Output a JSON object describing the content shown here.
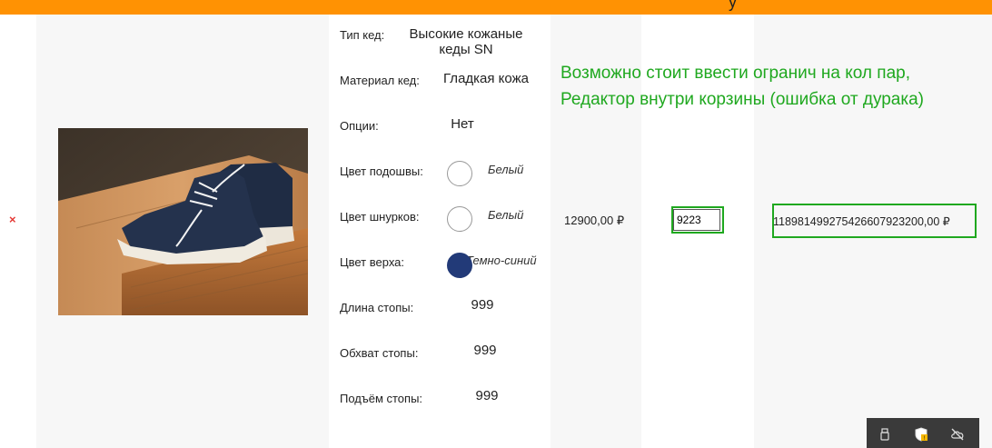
{
  "header": {
    "glyph": "у"
  },
  "cart_item": {
    "remove_label": "×",
    "options": [
      {
        "label": "Тип кед:",
        "value": "Высокие кожаные кеды SN"
      },
      {
        "label": "Материал кед:",
        "value": "Гладкая кожа"
      },
      {
        "label": "Опции:",
        "value": "Нет"
      },
      {
        "label": "Цвет подошвы:",
        "value": "Белый",
        "color": "#ffffff"
      },
      {
        "label": "Цвет шнурков:",
        "value": "Белый",
        "color": "#ffffff"
      },
      {
        "label": "Цвет верха:",
        "value": "Темно-синий",
        "color": "#223a78"
      },
      {
        "label": "Длина стопы:",
        "value": "999"
      },
      {
        "label": "Обхват стопы:",
        "value": "999"
      },
      {
        "label": "Подъём стопы:",
        "value": "999"
      }
    ],
    "price": "12900,00 ₽",
    "quantity": "9223",
    "total": "118981499275426607923200,00 ₽"
  },
  "annotation": {
    "text": "Возможно стоит ввести огранич на кол пар, Редактор внутри корзины (ошибка от дурака)"
  },
  "tray": {
    "icons": [
      "usb-icon",
      "shield-warning-icon",
      "cloud-off-icon"
    ]
  },
  "colors": {
    "accent": "#ff9203",
    "annotation": "#1fa81f",
    "remove": "#e53935"
  }
}
